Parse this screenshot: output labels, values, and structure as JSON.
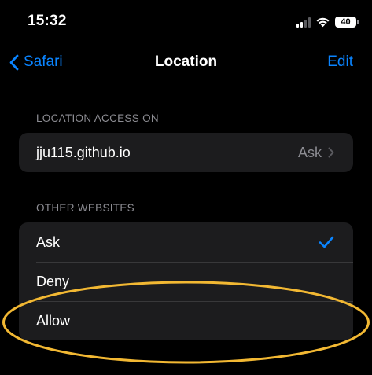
{
  "status_bar": {
    "time": "15:32",
    "battery_percent": "40",
    "icons": [
      "cellular-signal-icon",
      "wifi-icon",
      "battery-icon"
    ]
  },
  "nav": {
    "back_label": "Safari",
    "title": "Location",
    "edit_label": "Edit",
    "back_icon": "chevron-left-icon"
  },
  "location_access": {
    "header": "LOCATION ACCESS ON",
    "sites": [
      {
        "name": "jju115.github.io",
        "value": "Ask"
      }
    ]
  },
  "other_websites": {
    "header": "OTHER WEBSITES",
    "options": [
      {
        "label": "Ask",
        "selected": true
      },
      {
        "label": "Deny",
        "selected": false
      },
      {
        "label": "Allow",
        "selected": false
      }
    ]
  },
  "annotation": {
    "type": "highlight-ellipse",
    "target": "Allow",
    "color": "#f2b833"
  },
  "colors": {
    "accent": "#0a84ff",
    "background": "#000000",
    "cell_background": "#1c1c1e",
    "secondary_text": "#8d8d93"
  }
}
